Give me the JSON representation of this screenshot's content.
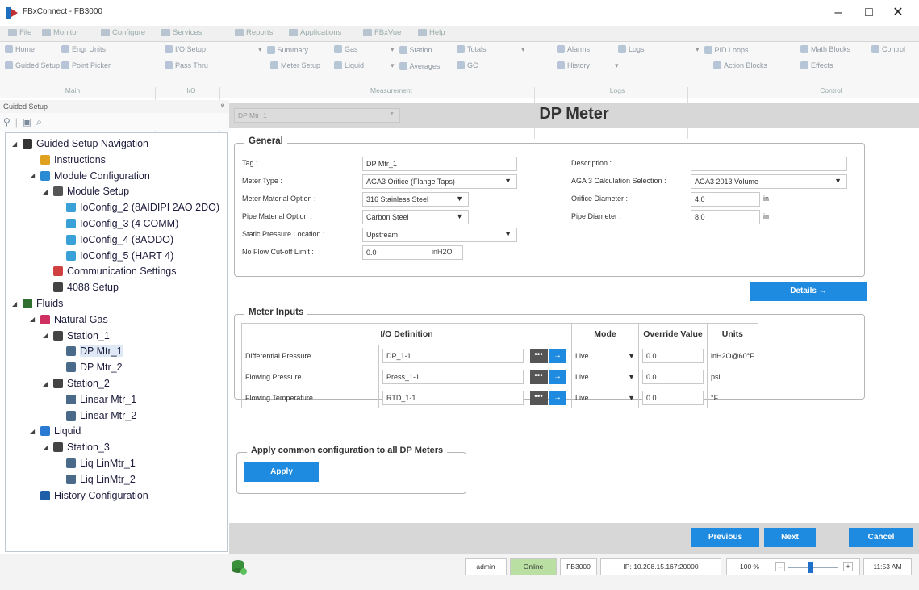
{
  "window": {
    "title": "FBxConnect - FB3000",
    "minimize": "–",
    "maximize": "□",
    "close": "✕"
  },
  "menu": [
    "File",
    "Monitor",
    "Configure",
    "Services",
    "Reports",
    "Applications",
    "FBxVue",
    "Help"
  ],
  "ribbon": {
    "main": {
      "items": [
        "Home",
        "Engr Units",
        "Guided Setup",
        "Point Picker"
      ],
      "group": "Main"
    },
    "io": {
      "items": [
        "I/O Setup",
        "Pass Thru"
      ],
      "group": "I/O"
    },
    "measurement": {
      "items": [
        "Summary",
        "Gas",
        "Station",
        "Totals",
        "Meter Setup",
        "Liquid",
        "Averages",
        "GC"
      ],
      "group": "Measurement"
    },
    "logs": {
      "items": [
        "Alarms",
        "Logs",
        "History"
      ],
      "group": "Logs"
    },
    "control": {
      "items": [
        "PID Loops",
        "Math Blocks",
        "Control",
        "Action Blocks",
        "Effects"
      ],
      "group": "Control"
    }
  },
  "sidebar": {
    "header": "Guided Setup",
    "pin": "ᵠ",
    "tree": [
      {
        "label": "Guided Setup Navigation",
        "icon": "gear-icon",
        "color": "#333333"
      },
      {
        "label": "Instructions",
        "icon": "bulb-icon",
        "color": "#e0a020"
      },
      {
        "label": "Module Configuration",
        "icon": "module-icon",
        "color": "#2a8ad4"
      },
      {
        "label": "Module Setup",
        "icon": "setup-icon",
        "color": "#555555"
      },
      {
        "label": "IoConfig_2 (8AIDIPI 2AO 2DO)",
        "icon": "io-icon",
        "color": "#3aa0d8"
      },
      {
        "label": "IoConfig_3 (4 COMM)",
        "icon": "io-icon",
        "color": "#3aa0d8"
      },
      {
        "label": "IoConfig_4 (8AODO)",
        "icon": "io-icon",
        "color": "#3aa0d8"
      },
      {
        "label": "IoConfig_5 (HART 4)",
        "icon": "io-icon",
        "color": "#3aa0d8"
      },
      {
        "label": "Communication Settings",
        "icon": "comm-icon",
        "color": "#d04040"
      },
      {
        "label": "4088 Setup",
        "icon": "transmitter-icon",
        "color": "#444444"
      },
      {
        "label": "Fluids",
        "icon": "fluids-icon",
        "color": "#2f6f2f"
      },
      {
        "label": "Natural Gas",
        "icon": "gas-icon",
        "color": "#d03060"
      },
      {
        "label": "Station_1",
        "icon": "station-icon",
        "color": "#444444"
      },
      {
        "label": "DP Mtr_1",
        "icon": "dp-meter-icon",
        "color": "#4a6a8a"
      },
      {
        "label": "DP Mtr_2",
        "icon": "dp-meter-icon",
        "color": "#4a6a8a"
      },
      {
        "label": "Station_2",
        "icon": "station-icon",
        "color": "#444444"
      },
      {
        "label": "Linear Mtr_1",
        "icon": "linear-meter-icon",
        "color": "#4a6a8a"
      },
      {
        "label": "Linear Mtr_2",
        "icon": "linear-meter-icon",
        "color": "#4a6a8a"
      },
      {
        "label": "Liquid",
        "icon": "liquid-icon",
        "color": "#2a7ad4"
      },
      {
        "label": "Station_3",
        "icon": "station-icon",
        "color": "#444444"
      },
      {
        "label": "Liq LinMtr_1",
        "icon": "linear-meter-icon",
        "color": "#4a6a8a"
      },
      {
        "label": "Liq LinMtr_2",
        "icon": "linear-meter-icon",
        "color": "#4a6a8a"
      },
      {
        "label": "History Configuration",
        "icon": "history-icon",
        "color": "#1f5fa8"
      }
    ]
  },
  "main": {
    "selector": "DP Mtr_1",
    "title": "DP Meter",
    "general": {
      "legend": "General",
      "tag_label": "Tag :",
      "tag": "DP Mtr_1",
      "meter_type_label": "Meter Type :",
      "meter_type": "AGA3 Orifice (Flange Taps)",
      "meter_material_label": "Meter Material Option :",
      "meter_material": "316 Stainless Steel",
      "pipe_material_label": "Pipe Material Option :",
      "pipe_material": "Carbon Steel",
      "static_pressure_label": "Static Pressure Location :",
      "static_pressure": "Upstream",
      "no_flow_label": "No Flow Cut-off Limit :",
      "no_flow": "0.0",
      "no_flow_unit": "inH2O",
      "description_label": "Description :",
      "description": "",
      "aga3_label": "AGA 3 Calculation Selection :",
      "aga3": "AGA3 2013 Volume",
      "orifice_label": "Orifice Diameter :",
      "orifice": "4.0",
      "orifice_unit": "in",
      "pipe_label": "Pipe Diameter :",
      "pipe": "8.0",
      "pipe_unit": "in"
    },
    "details_button": "Details →",
    "meter_inputs": {
      "legend": "Meter Inputs",
      "headers": [
        "I/O Definition",
        "Mode",
        "Override Value",
        "Units"
      ],
      "rows": [
        {
          "name": "Differential Pressure",
          "io": "DP_1-1",
          "mode": "Live",
          "override": "0.0",
          "units": "inH2O@60°F"
        },
        {
          "name": "Flowing Pressure",
          "io": "Press_1-1",
          "mode": "Live",
          "override": "0.0",
          "units": "psi"
        },
        {
          "name": "Flowing Temperature",
          "io": "RTD_1-1",
          "mode": "Live",
          "override": "0.0",
          "units": "°F"
        }
      ]
    },
    "apply_common": {
      "legend": "Apply common configuration to all DP Meters",
      "button": "Apply"
    },
    "footer": {
      "previous": "Previous",
      "next": "Next",
      "cancel": "Cancel"
    }
  },
  "status": {
    "user": "admin",
    "state": "Online",
    "device": "FB3000",
    "ip": "IP: 10.208.15.167:20000",
    "zoom": "100 %",
    "zoom_level": 0.45,
    "time": "11:53 AM"
  },
  "colors": {
    "accent": "#1e8be0",
    "online": "#b9dfa3"
  }
}
